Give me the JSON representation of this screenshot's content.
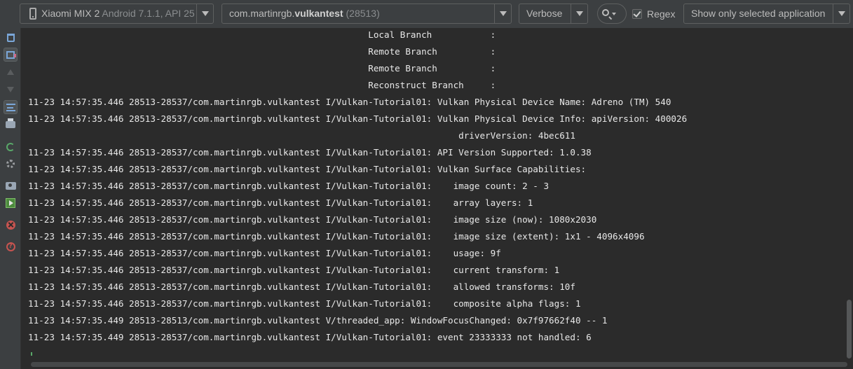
{
  "toolbar": {
    "device": {
      "name": "Xiaomi MIX 2",
      "details": " Android 7.1.1, API 25",
      "icon": "phone-icon"
    },
    "process": {
      "prefix": "com.martinrgb.",
      "bold": "vulkantest",
      "pid": " (28513)"
    },
    "log_level": {
      "selected": "Verbose"
    },
    "search": {
      "icon": "search-icon"
    },
    "regex": {
      "label": "Regex",
      "checked": true
    },
    "filter": {
      "selected": "Show only selected application"
    }
  },
  "gutter": {
    "buttons": [
      {
        "name": "clear-logcat-button",
        "icon": "trash-icon"
      },
      {
        "name": "scroll-to-end-button",
        "icon": "scroll-to-end-icon"
      },
      {
        "name": "up-the-stack-button",
        "icon": "arrow-up-icon"
      },
      {
        "name": "down-the-stack-button",
        "icon": "arrow-down-icon"
      },
      {
        "name": "soft-wrap-button",
        "icon": "soft-wrap-icon"
      },
      {
        "name": "print-button",
        "icon": "print-icon"
      },
      {
        "name": "restart-button",
        "icon": "restart-icon"
      },
      {
        "name": "settings-button",
        "icon": "gear-icon"
      },
      {
        "name": "screen-capture-button",
        "icon": "camera-icon"
      },
      {
        "name": "screen-record-button",
        "icon": "record-icon"
      },
      {
        "name": "terminate-app-button",
        "icon": "stop-icon"
      },
      {
        "name": "help-button",
        "icon": "help-icon"
      }
    ]
  },
  "log": {
    "lines": [
      "                                                                Local Branch           :",
      "                                                                Remote Branch          :",
      "                                                                Remote Branch          :",
      "                                                                Reconstruct Branch     :",
      "11-23 14:57:35.446 28513-28537/com.martinrgb.vulkantest I/Vulkan-Tutorial01: Vulkan Physical Device Name: Adreno (TM) 540",
      "11-23 14:57:35.446 28513-28537/com.martinrgb.vulkantest I/Vulkan-Tutorial01: Vulkan Physical Device Info: apiVersion: 400026",
      "                                                                                 driverVersion: 4bec611",
      "11-23 14:57:35.446 28513-28537/com.martinrgb.vulkantest I/Vulkan-Tutorial01: API Version Supported: 1.0.38",
      "11-23 14:57:35.446 28513-28537/com.martinrgb.vulkantest I/Vulkan-Tutorial01: Vulkan Surface Capabilities:",
      "11-23 14:57:35.446 28513-28537/com.martinrgb.vulkantest I/Vulkan-Tutorial01:    image count: 2 - 3",
      "11-23 14:57:35.446 28513-28537/com.martinrgb.vulkantest I/Vulkan-Tutorial01:    array layers: 1",
      "11-23 14:57:35.446 28513-28537/com.martinrgb.vulkantest I/Vulkan-Tutorial01:    image size (now): 1080x2030",
      "11-23 14:57:35.446 28513-28537/com.martinrgb.vulkantest I/Vulkan-Tutorial01:    image size (extent): 1x1 - 4096x4096",
      "11-23 14:57:35.446 28513-28537/com.martinrgb.vulkantest I/Vulkan-Tutorial01:    usage: 9f",
      "11-23 14:57:35.446 28513-28537/com.martinrgb.vulkantest I/Vulkan-Tutorial01:    current transform: 1",
      "11-23 14:57:35.446 28513-28537/com.martinrgb.vulkantest I/Vulkan-Tutorial01:    allowed transforms: 10f",
      "11-23 14:57:35.446 28513-28537/com.martinrgb.vulkantest I/Vulkan-Tutorial01:    composite alpha flags: 1",
      "11-23 14:57:35.449 28513-28513/com.martinrgb.vulkantest V/threaded_app: WindowFocusChanged: 0x7f97662f40 -- 1",
      "11-23 14:57:35.449 28513-28537/com.martinrgb.vulkantest I/Vulkan-Tutorial01: event 23333333 not handled: 6"
    ]
  },
  "colors": {
    "background": "#2b2b2b",
    "toolbar": "#3c3f41",
    "text": "#e8e8e8",
    "muted": "#8a8d8f"
  }
}
